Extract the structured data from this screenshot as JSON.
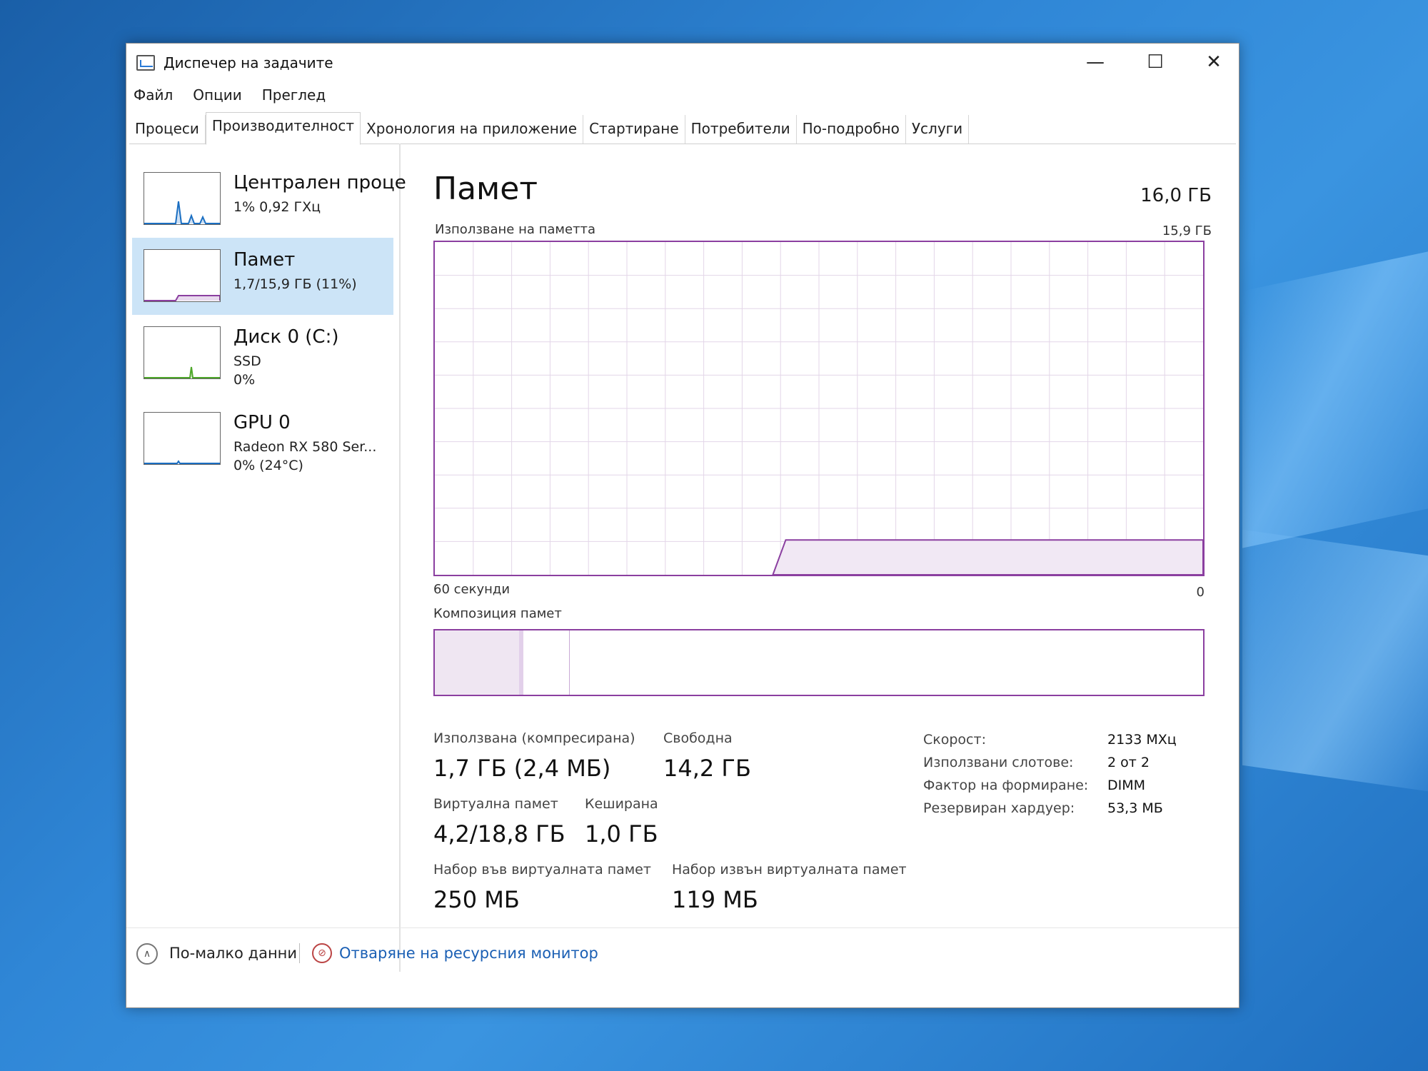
{
  "window": {
    "title": "Диспечер на задачите",
    "controls": {
      "minimize": "—",
      "maximize": "☐",
      "close": "✕"
    }
  },
  "menu": [
    "Файл",
    "Опции",
    "Преглед"
  ],
  "tabs": [
    {
      "label": "Процеси",
      "active": false
    },
    {
      "label": "Производителност",
      "active": true
    },
    {
      "label": "Хронология на приложение",
      "active": false
    },
    {
      "label": "Стартиране",
      "active": false
    },
    {
      "label": "Потребители",
      "active": false
    },
    {
      "label": "По-подробно",
      "active": false
    },
    {
      "label": "Услуги",
      "active": false
    }
  ],
  "sidebar": [
    {
      "name": "Централен проце",
      "lines": [
        "1% 0,92 ГХц"
      ],
      "color": "#1b6fc2",
      "selected": false
    },
    {
      "name": "Памет",
      "lines": [
        "1,7/15,9 ГБ (11%)"
      ],
      "color": "#8b3fa0",
      "selected": true
    },
    {
      "name": "Диск 0 (C:)",
      "lines": [
        "SSD",
        "0%"
      ],
      "color": "#4ea72a",
      "selected": false
    },
    {
      "name": "GPU 0",
      "lines": [
        "Radeon RX 580 Ser...",
        "0% (24°C)"
      ],
      "color": "#1b6fc2",
      "selected": false
    }
  ],
  "memory": {
    "heading": "Памет",
    "total": "16,0 ГБ",
    "usage_label": "Използване на паметта",
    "usage_max": "15,9 ГБ",
    "time_left": "60 секунди",
    "time_right": "0",
    "composition_label": "Композиция памет",
    "composition": {
      "in_use_fraction": 0.11,
      "modified_fraction": 0.005,
      "standby_fraction": 0.06
    },
    "usage_fraction": 0.11,
    "accent": "#8b3fa0"
  },
  "stats": {
    "in_use_label": "Използвана (компресирана)",
    "in_use_value": "1,7 ГБ (2,4 МБ)",
    "available_label": "Свободна",
    "available_value": "14,2 ГБ",
    "committed_label": "Виртуална памет",
    "committed_value": "4,2/18,8 ГБ",
    "cached_label": "Кеширана",
    "cached_value": "1,0 ГБ",
    "paged_label": "Набор във виртуалната памет",
    "paged_value": "250 МБ",
    "nonpaged_label": "Набор извън виртуалната памет",
    "nonpaged_value": "119 МБ"
  },
  "details": [
    {
      "key": "Скорост:",
      "value": "2133 МХц"
    },
    {
      "key": "Използвани слотове:",
      "value": "2 от 2"
    },
    {
      "key": "Фактор на формиране:",
      "value": "DIMM"
    },
    {
      "key": "Резервиран хардуер:",
      "value": "53,3 МБ"
    }
  ],
  "footer": {
    "fewer_details": "По-малко данни",
    "open_resmon": "Отваряне на ресурсния монитор",
    "link_color": "#1a5fb4"
  },
  "icons": {
    "app": "task-manager-icon",
    "fewer": "chevron-up-icon",
    "resmon": "resource-monitor-icon"
  }
}
